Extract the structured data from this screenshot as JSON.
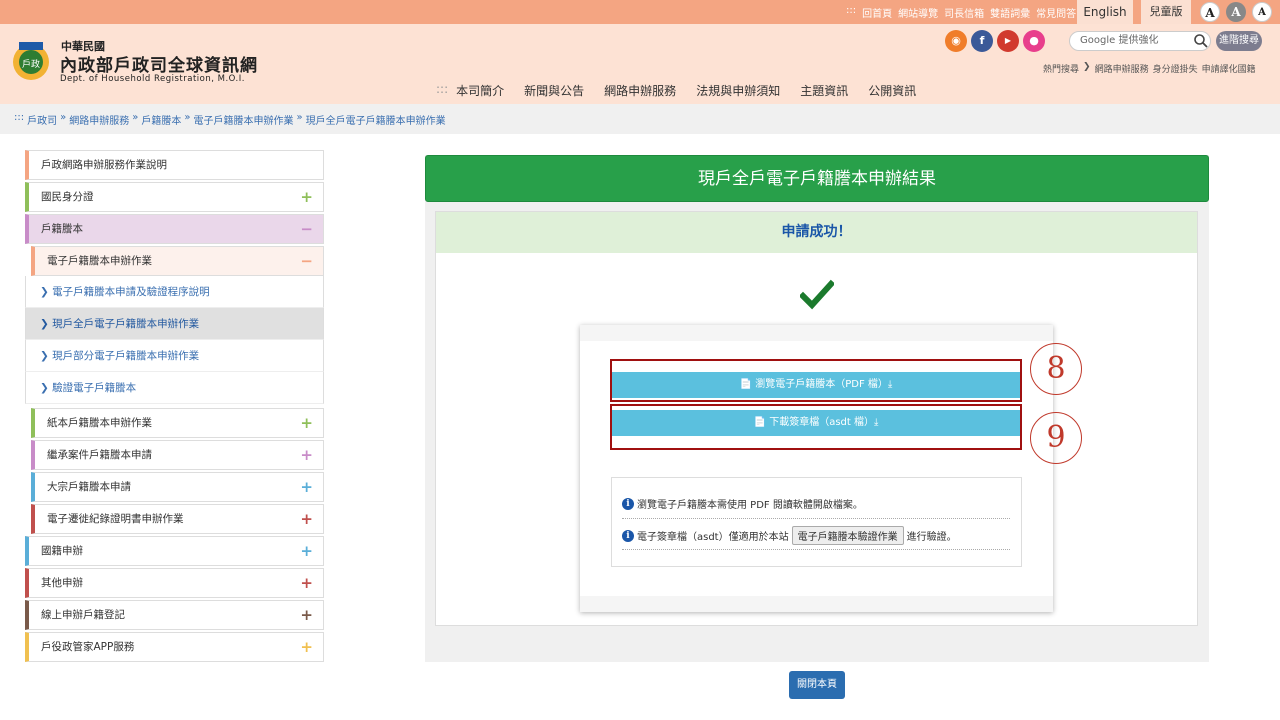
{
  "header": {
    "top_links": [
      ":::",
      "回首頁",
      "網站導覽",
      "司長信箱",
      "雙語詞彙",
      "常見問答"
    ],
    "english_label": "English",
    "kids_label": "兒童版",
    "font_sizes": [
      "A",
      "A",
      "A"
    ],
    "logo_line1": "中華民國",
    "logo_line2": "內政部戶政司全球資訊網",
    "logo_line3": "Dept. of Household Registration, M.O.I.",
    "search_placeholder": "Google 提供強化",
    "adv_search_label": "進階搜尋",
    "hotwords": [
      "熱門搜尋",
      "❯",
      "網路申辦服務",
      "身分證掛失",
      "申請譯化國籍"
    ],
    "nav": [
      ":::",
      "本司簡介",
      "新聞與公告",
      "網路申辦服務",
      "法規與申辦須知",
      "主題資訊",
      "公開資訊"
    ]
  },
  "breadcrumb": [
    ":::",
    "戶政司",
    "»",
    "網路申辦服務",
    "»",
    "戶籍謄本",
    "»",
    "電子戶籍謄本申辦作業",
    "»",
    "現戶全戶電子戶籍謄本申辦作業"
  ],
  "sidebar": {
    "items": [
      {
        "label": "戶政網路申辦服務作業說明",
        "color": "#f4a582",
        "sign": ""
      },
      {
        "label": "國民身分證",
        "color": "#8fbf5a",
        "sign": "+"
      },
      {
        "label": "戶籍謄本",
        "color": "#c88cc8",
        "sign": "−"
      }
    ],
    "sub_head": {
      "label": "電子戶籍謄本申辦作業",
      "sign": "−"
    },
    "subs": [
      "❯ 電子戶籍謄本申請及驗證程序說明",
      "❯ 現戶全戶電子戶籍謄本申辦作業",
      "❯ 現戶部分電子戶籍謄本申辦作業",
      "❯ 驗證電子戶籍謄本"
    ],
    "items2": [
      {
        "label": "紙本戶籍謄本申辦作業",
        "color": "#8fbf5a",
        "sign": "+"
      },
      {
        "label": "繼承案件戶籍謄本申請",
        "color": "#c88cc8",
        "sign": "+"
      },
      {
        "label": "大宗戶籍謄本申請",
        "color": "#5aaed8",
        "sign": "+"
      },
      {
        "label": "電子遷徙紀錄證明書申辦作業",
        "color": "#c0504d",
        "sign": "+"
      },
      {
        "label": "國籍申辦",
        "color": "#5aaed8",
        "sign": "+"
      },
      {
        "label": "其他申辦",
        "color": "#c0504d",
        "sign": "+"
      },
      {
        "label": "線上申辦戶籍登記",
        "color": "#7a5a4a",
        "sign": "+"
      },
      {
        "label": "戶役政管家APP服務",
        "color": "#f0c050",
        "sign": "+"
      }
    ]
  },
  "main": {
    "title": "現戶全戶電子戶籍謄本申辦結果",
    "success": "申請成功！",
    "btn_pdf": "📄 瀏覽電子戶籍謄本（PDF 檔）⤓",
    "btn_asdt": "📄 下載簽章檔（asdt 檔）⤓",
    "annot_8": "8",
    "annot_9": "9",
    "note1": "瀏覽電子戶籍謄本需使用 PDF 閱讀軟體開啟檔案。",
    "note2_pre": "電子簽章檔（asdt）僅適用於本站",
    "note2_btn": "電子戶籍謄本驗證作業",
    "note2_post": "進行驗證。",
    "close": "關閉本頁"
  }
}
